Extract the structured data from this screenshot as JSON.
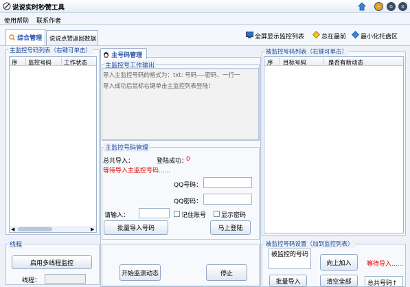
{
  "window": {
    "title": "说说实时秒赞工具"
  },
  "menu": {
    "items": [
      "使用帮助",
      "联系作者"
    ]
  },
  "tabs": {
    "main": "综合管理",
    "second": "说说点赞返回数据"
  },
  "toolbar": {
    "fullscreen": "全屏显示监控列表",
    "ontop": "总在最前",
    "minimize": "最小化托盘区"
  },
  "left_list": {
    "title": "主监控号码列表（右键可单击）",
    "columns": [
      "序",
      "监控号码",
      "工作状态"
    ]
  },
  "thread": {
    "title": "线程",
    "start_button": "启用多线程监控",
    "thread_label": "线程："
  },
  "center": {
    "tab": "主号码管理",
    "output": {
      "title": "主监控号工作输出",
      "lines": [
        "导入主监控号码的格式为：txt:  号码----密码、一行一",
        "导入成功后鼠标右键单击主监控列表登陆！"
      ]
    },
    "manage": {
      "title": "主监控号码管理",
      "total_label": "总共导入：",
      "success_label": "登陆成功：",
      "success_value": "0",
      "waiting": "等待导入主监控号码......",
      "qq_label": "QQ号码：",
      "pwd_label": "QQ密码：",
      "input_label": "请输入：",
      "remember": "记住账号",
      "show_pwd": "显示密码",
      "batch_import": "批量导入号码",
      "login_now": "马上登陆"
    },
    "start_monitor": "开始监测动态",
    "stop": "停止"
  },
  "right_list": {
    "title": "被监控号码列表（右键可单击）",
    "columns": [
      "序",
      "目标号码",
      "是否有新动态"
    ]
  },
  "monitored": {
    "title": "被监控号码设置（加到监控列表）",
    "field_label": "被监控的号码",
    "add_button": "向上加入",
    "waiting": "等待导入......",
    "batch_import": "批量导入",
    "clear_all": "清空全部",
    "total_label": "总共号码↑"
  },
  "colors": {
    "accent": "#1e4a9a",
    "warning": "#e00000",
    "border": "#9fb3cc"
  }
}
